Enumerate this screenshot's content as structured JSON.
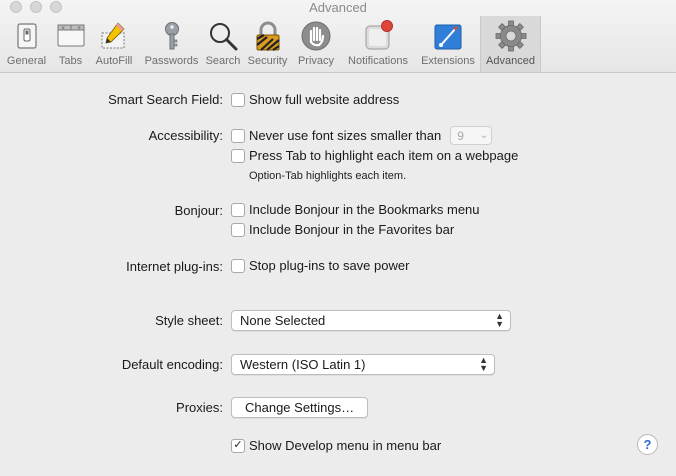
{
  "window": {
    "title": "Advanced"
  },
  "toolbar": {
    "tabs": [
      {
        "label": "General",
        "icon": "general-icon"
      },
      {
        "label": "Tabs",
        "icon": "tabs-icon"
      },
      {
        "label": "AutoFill",
        "icon": "autofill-icon"
      },
      {
        "label": "Passwords",
        "icon": "key-icon"
      },
      {
        "label": "Search",
        "icon": "search-icon"
      },
      {
        "label": "Security",
        "icon": "lock-icon"
      },
      {
        "label": "Privacy",
        "icon": "hand-icon"
      },
      {
        "label": "Notifications",
        "icon": "notifications-icon"
      },
      {
        "label": "Extensions",
        "icon": "extensions-icon"
      },
      {
        "label": "Advanced",
        "icon": "gear-icon"
      }
    ],
    "active_tab": "Advanced"
  },
  "settings": {
    "smart_search": {
      "label": "Smart Search Field:",
      "option": "Show full website address",
      "checked": false
    },
    "accessibility": {
      "label": "Accessibility:",
      "min_font": {
        "option": "Never use font sizes smaller than",
        "checked": false,
        "value": "9"
      },
      "press_tab": {
        "option": "Press Tab to highlight each item on a webpage",
        "checked": false
      },
      "hint": "Option-Tab highlights each item."
    },
    "bonjour": {
      "label": "Bonjour:",
      "bookmarks": {
        "option": "Include Bonjour in the Bookmarks menu",
        "checked": false
      },
      "favorites": {
        "option": "Include Bonjour in the Favorites bar",
        "checked": false
      }
    },
    "plugins": {
      "label": "Internet plug-ins:",
      "option": "Stop plug-ins to save power",
      "checked": false
    },
    "style_sheet": {
      "label": "Style sheet:",
      "value": "None Selected"
    },
    "encoding": {
      "label": "Default encoding:",
      "value": "Western (ISO Latin 1)"
    },
    "proxies": {
      "label": "Proxies:",
      "button": "Change Settings…"
    },
    "develop": {
      "option": "Show Develop menu in menu bar",
      "checked": true,
      "check_glyph": "✓"
    }
  },
  "help": {
    "glyph": "?"
  },
  "colors": {
    "help_blue": "#2d6bd6",
    "notification_badge": "#e0443a",
    "extensions_blue": "#2f7fd8"
  }
}
